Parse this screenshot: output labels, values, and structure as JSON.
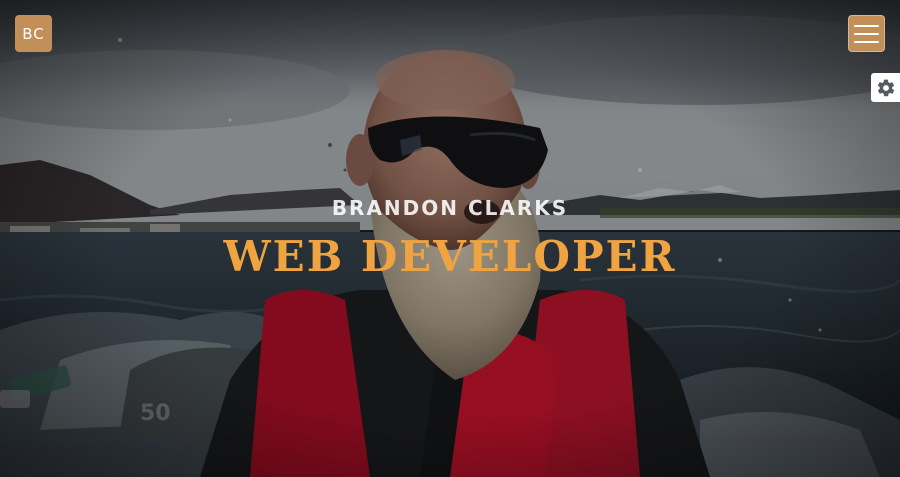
{
  "logo": {
    "initials": "BC"
  },
  "header": {
    "menu_icon": "hamburger-menu-icon",
    "settings_icon": "gear-icon"
  },
  "hero": {
    "name": "BRANDON CLARKS",
    "title": "WEB DEVELOPER"
  },
  "colors": {
    "accent": "#c28f59",
    "title": "#f0a441",
    "name": "#ffffff",
    "settings_bg": "#ffffff"
  },
  "background": {
    "description_icon": "photo-background"
  }
}
